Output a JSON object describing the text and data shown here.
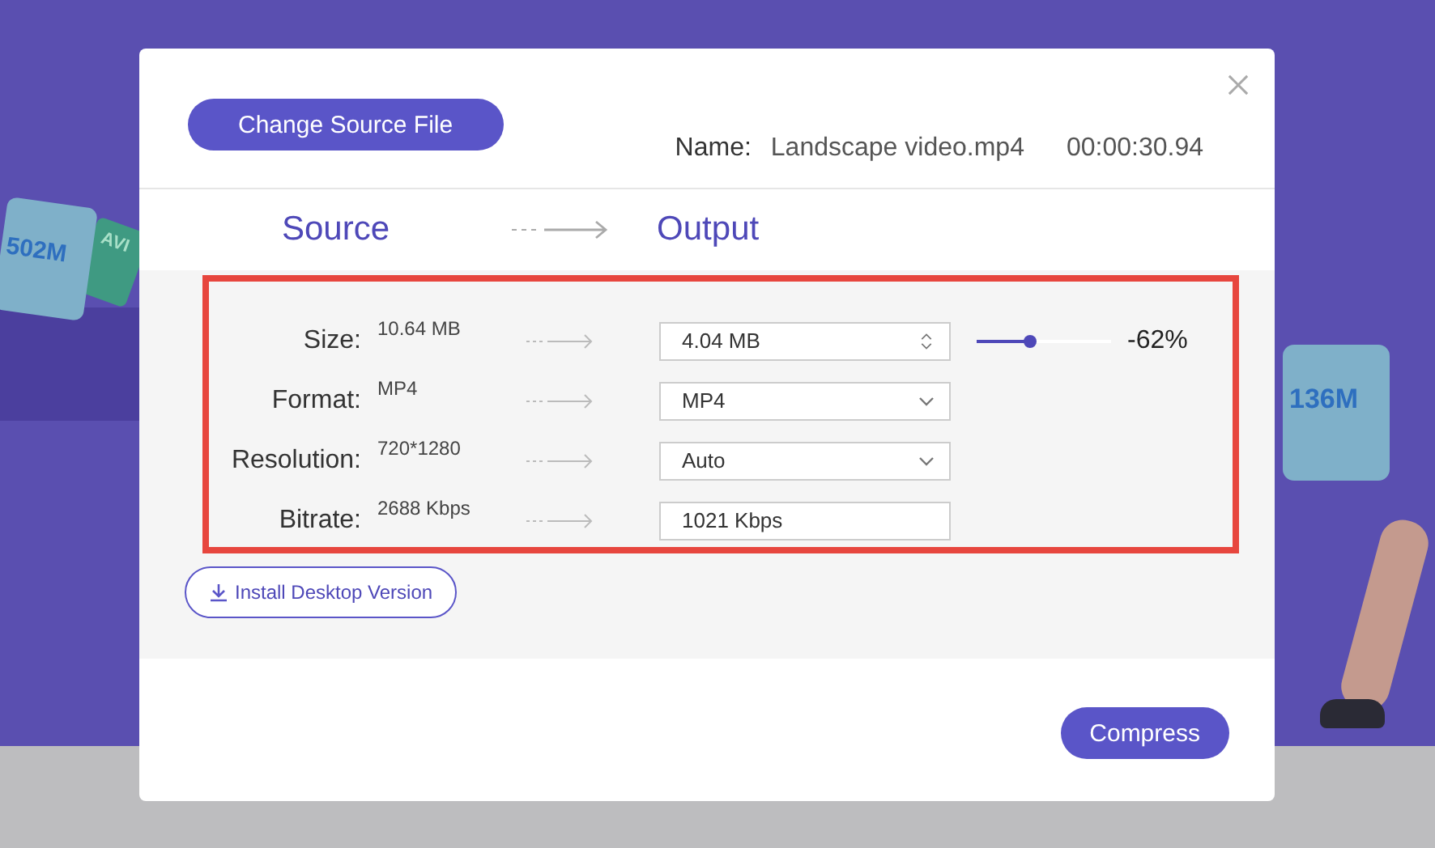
{
  "background": {
    "left_file_label": "502M",
    "left_tag_label": "AVI",
    "right_file_label": "136M"
  },
  "dialog": {
    "change_source_button": "Change Source File",
    "name_label": "Name:",
    "file_name": "Landscape video.mp4",
    "duration": "00:00:30.94",
    "source_heading": "Source",
    "output_heading": "Output",
    "settings": [
      {
        "label": "Size:",
        "source": "10.64  MB",
        "kind": "spinner",
        "output": "4.04  MB",
        "slider": {
          "level": 0.4,
          "reading": "-62%"
        }
      },
      {
        "label": "Format:",
        "source": "MP4",
        "kind": "select",
        "output": "MP4"
      },
      {
        "label": "Resolution:",
        "source": "720*1280",
        "kind": "select",
        "output": "Auto"
      },
      {
        "label": "Bitrate:",
        "source": "2688  Kbps",
        "kind": "text",
        "output": "1021 Kbps"
      }
    ],
    "install_button": "Install Desktop Version",
    "compress_button": "Compress"
  }
}
